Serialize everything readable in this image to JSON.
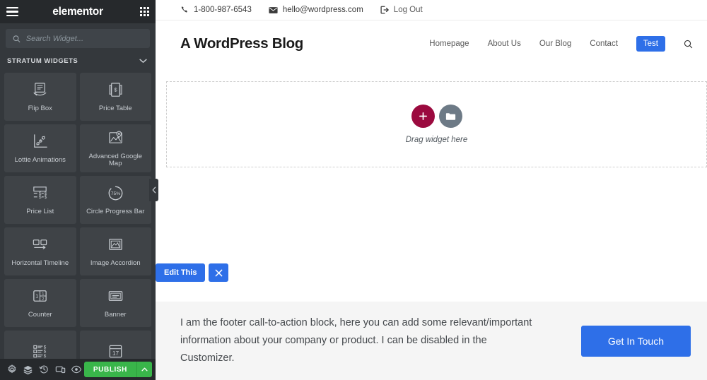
{
  "panel": {
    "logo": "elementor",
    "menu_icon": "hamburger-icon",
    "apps_icon": "grid-apps-icon",
    "search": {
      "placeholder": "Search Widget...",
      "value": "",
      "icon": "search-icon"
    },
    "category": {
      "title": "STRATUM WIDGETS",
      "chevron": "chevron-down-icon"
    },
    "widgets": [
      {
        "label": "Flip Box",
        "icon": "flip-box-icon"
      },
      {
        "label": "Price Table",
        "icon": "price-table-icon"
      },
      {
        "label": "Lottie Animations",
        "icon": "lottie-animations-icon"
      },
      {
        "label": "Advanced Google Map",
        "icon": "advanced-google-map-icon"
      },
      {
        "label": "Price List",
        "icon": "price-list-icon"
      },
      {
        "label": "Circle Progress Bar",
        "icon": "circle-progress-bar-icon"
      },
      {
        "label": "Horizontal Timeline",
        "icon": "horizontal-timeline-icon"
      },
      {
        "label": "Image Accordion",
        "icon": "image-accordion-icon"
      },
      {
        "label": "Counter",
        "icon": "counter-icon"
      },
      {
        "label": "Banner",
        "icon": "banner-icon"
      },
      {
        "label": "",
        "icon": "price-menu-icon"
      },
      {
        "label": "",
        "icon": "calendar-icon"
      }
    ],
    "collapse_icon": "chevron-left-icon",
    "footer": {
      "settings_icon": "gear-icon",
      "navigator_icon": "layers-icon",
      "history_icon": "history-icon",
      "responsive_icon": "responsive-mode-icon",
      "preview_icon": "eye-icon",
      "publish_label": "PUBLISH",
      "publish_arrow_icon": "chevron-up-icon"
    }
  },
  "preview": {
    "topbar": {
      "phone": "1-800-987-6543",
      "phone_icon": "phone-icon",
      "email": "hello@wordpress.com",
      "email_icon": "envelope-icon",
      "logout": "Log Out",
      "logout_icon": "logout-icon"
    },
    "site": {
      "title": "A WordPress Blog",
      "nav": [
        {
          "label": "Homepage",
          "active": false
        },
        {
          "label": "About Us",
          "active": false
        },
        {
          "label": "Our Blog",
          "active": false
        },
        {
          "label": "Contact",
          "active": false
        }
      ],
      "nav_button": "Test",
      "search_icon": "search-icon"
    },
    "dropzone": {
      "label": "Drag widget here",
      "add_icon": "plus-icon",
      "folder_icon": "folder-icon",
      "add_color": "#9b0a3f",
      "folder_color": "#6d7a86"
    },
    "edit_bar": {
      "edit_label": "Edit This",
      "close_icon": "close-x-icon"
    },
    "footer_cta": {
      "text": "I am the footer call-to-action block, here you can add some relevant/important information about your company or product. I can be disabled in the Customizer.",
      "button_label": "Get In Touch"
    }
  },
  "colors": {
    "panel_bg": "#34383c",
    "panel_header_bg": "#26292c",
    "card_bg": "#3f4347",
    "accent_blue": "#2e6fe8",
    "publish_green": "#39b54a",
    "crimson": "#9b0a3f"
  }
}
